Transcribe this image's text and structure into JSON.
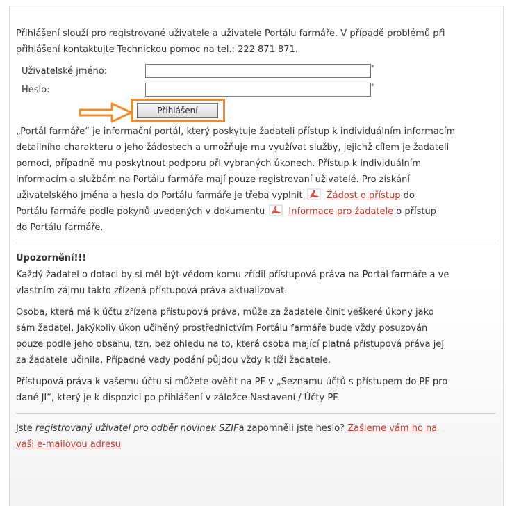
{
  "intro": {
    "line1": "Přihlášení slouží pro registrované uživatele a uživatele Portálu farmáře. V případě problémů při",
    "line2": "přihlášení kontaktujte Technickou pomoc na tel.: 222 871 871."
  },
  "form": {
    "username_label": "Uživatelské jméno:",
    "username_value": "",
    "password_label": "Heslo:",
    "password_value": "",
    "required_mark": "*",
    "login_button": "Přihlášení"
  },
  "description": {
    "lines": [
      "„Portál farmáře“ je informační portál, který poskytuje žadateli přístup k individuálním informacím",
      "detailního charakteru o jeho žádostech a umožňuje mu využívat služby, jejichž cílem je žadateli",
      "pomoci, případně mu poskytnout podporu při vybraných úkonech. Přístup k individuálním",
      "informacím a službám na Portálu farmáře mají pouze registrovaní uživatelé. Pro získání"
    ],
    "line5_prefix": "uživatelského jména a hesla do Portálu farmáře je třeba vyplnit",
    "link_zadost": "Žádost o přístup",
    "line5_suffix": "do",
    "line6_prefix": "Portálu farmáře podle pokynů uvedených v dokumentu",
    "link_informace": "Informace pro žadatele",
    "line6_suffix": "o přístup",
    "line7": "do Portálu farmáře."
  },
  "warning": {
    "title": "Upozornění!!!",
    "p1_lines": [
      "Každý žadatel o dotaci by si měl být vědom komu zřídil přístupová práva na Portál farmáře a ve",
      "vlastním zájmu takto zřízená přístupová práva aktualizovat."
    ],
    "p2_lines": [
      "Osoba, která má k účtu zřízena přístupová práva, může za žadatele činit veškeré úkony jako",
      "sám žadatel. Jakýkoliv úkon učiněný prostřednictvím Portálu farmáře bude vždy posuzován",
      "pouze podle jeho obsahu, tzn. bez ohledu na to, která osoba mající platná přístupová práva jej",
      "za žadatele učinila. Případné vady podání půjdou vždy k tíži žadatele."
    ],
    "p3_lines": [
      "Přístupová práva k vašemu účtu si můžete ověřit na PF v „Seznamu účtů s přístupem do PF pro",
      "dané JI“, který je k dispozici po přihlášení v záložce Nastavení / Účty PF."
    ]
  },
  "footer": {
    "prefix": "Jste",
    "italic": "registrovaný uživatel pro odběr novinek SZIF",
    "middle": "a zapomněli jste heslo?",
    "link_part1": "Zašleme vám ho na",
    "link_part2": "vaši e-mailovou adresu"
  },
  "colors": {
    "link": "#c8382c",
    "highlight": "#f28c28",
    "pdf_icon": "#d9463a"
  },
  "icons": {
    "pdf": "pdf-document-icon",
    "arrow": "arrow-right-icon"
  }
}
